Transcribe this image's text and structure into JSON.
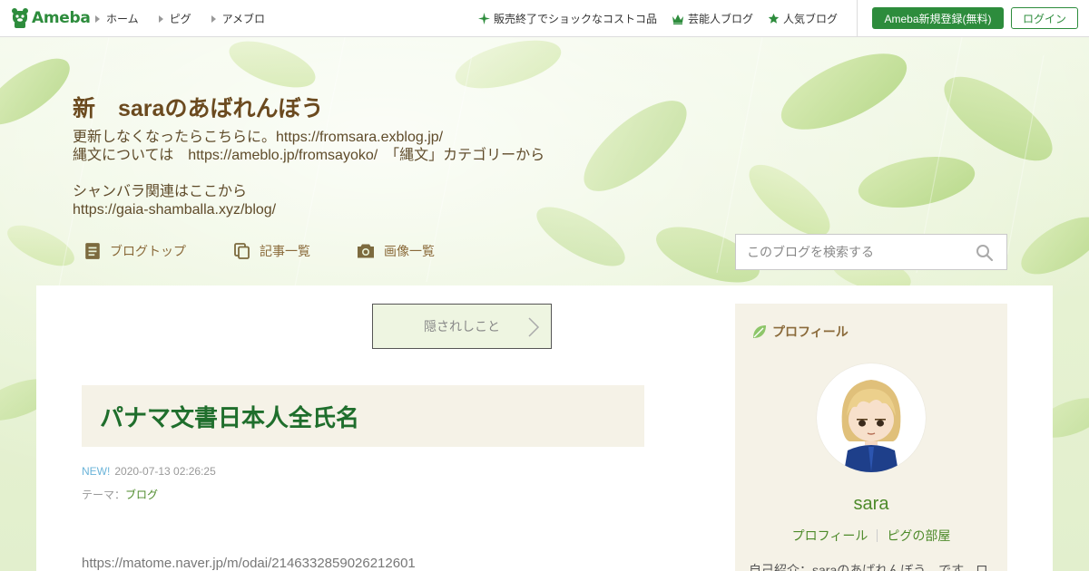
{
  "topbar": {
    "logo_text": "Ameba",
    "nav_left": [
      "ホーム",
      "ピグ",
      "アメブロ"
    ],
    "nav_right": [
      {
        "icon": "sparkle-icon",
        "label": "販売終了でショックなコストコ品"
      },
      {
        "icon": "crown-icon",
        "label": "芸能人ブログ"
      },
      {
        "icon": "star-icon",
        "label": "人気ブログ"
      }
    ],
    "register_label": "Ameba新規登録(無料)",
    "login_label": "ログイン"
  },
  "header": {
    "title": "新　saraのあばれんぼう",
    "description": [
      "更新しなくなったらこちらに。https://fromsara.exblog.jp/",
      "縄文については　https://ameblo.jp/fromsayoko/　「縄文」カテゴリーから",
      "",
      "シャンバラ関連はここから",
      "https://gaia-shamballa.xyz/blog/"
    ],
    "tabs": [
      {
        "icon": "document-icon",
        "label": "ブログトップ"
      },
      {
        "icon": "copy-icon",
        "label": "記事一覧"
      },
      {
        "icon": "camera-icon",
        "label": "画像一覧"
      }
    ],
    "search_placeholder": "このブログを検索する"
  },
  "main": {
    "prev_entry": "隠されしこと",
    "article": {
      "title": "パナマ文書日本人全氏名",
      "new_badge": "NEW!",
      "datetime": "2020-07-13 02:26:25",
      "theme_label": "テーマ：",
      "theme": "ブログ",
      "body_link": "https://matome.naver.jp/m/odai/2146332859026212601"
    }
  },
  "sidebar": {
    "heading": "プロフィール",
    "name": "sara",
    "links": [
      "プロフィール",
      "ピグの部屋"
    ],
    "intro": "自己紹介：saraのあばれんぼう、です。ロ"
  },
  "colors": {
    "brand_green": "#2d8c3c",
    "title_brown": "#6b4a1f",
    "article_title_green": "#1f6e2c",
    "link_green": "#4d8a2a",
    "new_blue": "#6bb4d9",
    "panel_beige": "#f5f2e7"
  }
}
